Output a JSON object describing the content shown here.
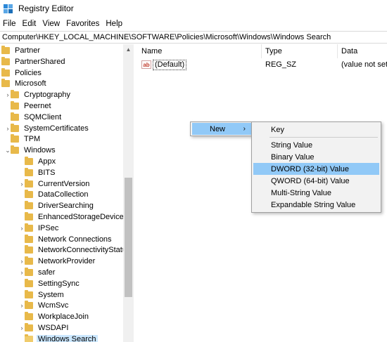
{
  "window": {
    "title": "Registry Editor"
  },
  "menu": [
    "File",
    "Edit",
    "View",
    "Favorites",
    "Help"
  ],
  "address": "Computer\\HKEY_LOCAL_MACHINE\\SOFTWARE\\Policies\\Microsoft\\Windows\\Windows Search",
  "tree": [
    {
      "label": "Partner",
      "level": 0,
      "expander": "",
      "folder": true
    },
    {
      "label": "PartnerShared",
      "level": 0,
      "expander": "",
      "folder": true
    },
    {
      "label": "Policies",
      "level": 0,
      "expander": "",
      "folder": true
    },
    {
      "label": "Microsoft",
      "level": 0,
      "expander": "open",
      "folder": true
    },
    {
      "label": "Cryptography",
      "level": 1,
      "expander": "closed",
      "folder": true
    },
    {
      "label": "Peernet",
      "level": 1,
      "expander": "",
      "folder": true
    },
    {
      "label": "SQMClient",
      "level": 1,
      "expander": "",
      "folder": true
    },
    {
      "label": "SystemCertificates",
      "level": 1,
      "expander": "closed",
      "folder": true
    },
    {
      "label": "TPM",
      "level": 1,
      "expander": "",
      "folder": true
    },
    {
      "label": "Windows",
      "level": 1,
      "expander": "open",
      "folder": true
    },
    {
      "label": "Appx",
      "level": 2,
      "expander": "",
      "folder": true
    },
    {
      "label": "BITS",
      "level": 2,
      "expander": "",
      "folder": true
    },
    {
      "label": "CurrentVersion",
      "level": 2,
      "expander": "closed",
      "folder": true
    },
    {
      "label": "DataCollection",
      "level": 2,
      "expander": "",
      "folder": true
    },
    {
      "label": "DriverSearching",
      "level": 2,
      "expander": "",
      "folder": true
    },
    {
      "label": "EnhancedStorageDevices",
      "level": 2,
      "expander": "",
      "folder": true
    },
    {
      "label": "IPSec",
      "level": 2,
      "expander": "closed",
      "folder": true
    },
    {
      "label": "Network Connections",
      "level": 2,
      "expander": "",
      "folder": true
    },
    {
      "label": "NetworkConnectivityStatu",
      "level": 2,
      "expander": "",
      "folder": true
    },
    {
      "label": "NetworkProvider",
      "level": 2,
      "expander": "closed",
      "folder": true
    },
    {
      "label": "safer",
      "level": 2,
      "expander": "closed",
      "folder": true
    },
    {
      "label": "SettingSync",
      "level": 2,
      "expander": "",
      "folder": true
    },
    {
      "label": "System",
      "level": 2,
      "expander": "",
      "folder": true
    },
    {
      "label": "WcmSvc",
      "level": 2,
      "expander": "closed",
      "folder": true
    },
    {
      "label": "WorkplaceJoin",
      "level": 2,
      "expander": "",
      "folder": true
    },
    {
      "label": "WSDAPI",
      "level": 2,
      "expander": "closed",
      "folder": true
    },
    {
      "label": "Windows Search",
      "level": 2,
      "expander": "",
      "folder": true,
      "selected": true
    }
  ],
  "columns": {
    "name": "Name",
    "type": "Type",
    "data": "Data"
  },
  "values": [
    {
      "icon": "ab",
      "name": "(Default)",
      "type": "REG_SZ",
      "data": "(value not set)"
    }
  ],
  "context_menu": {
    "new_label": "New",
    "submenu": [
      {
        "label": "Key",
        "highlighted": false
      },
      {
        "label": "String Value",
        "highlighted": false
      },
      {
        "label": "Binary Value",
        "highlighted": false
      },
      {
        "label": "DWORD (32-bit) Value",
        "highlighted": true
      },
      {
        "label": "QWORD (64-bit) Value",
        "highlighted": false
      },
      {
        "label": "Multi-String Value",
        "highlighted": false
      },
      {
        "label": "Expandable String Value",
        "highlighted": false
      }
    ]
  },
  "colors": {
    "highlight": "#91c9f7",
    "selection": "#cce8ff",
    "folder": "#e8b94a"
  }
}
